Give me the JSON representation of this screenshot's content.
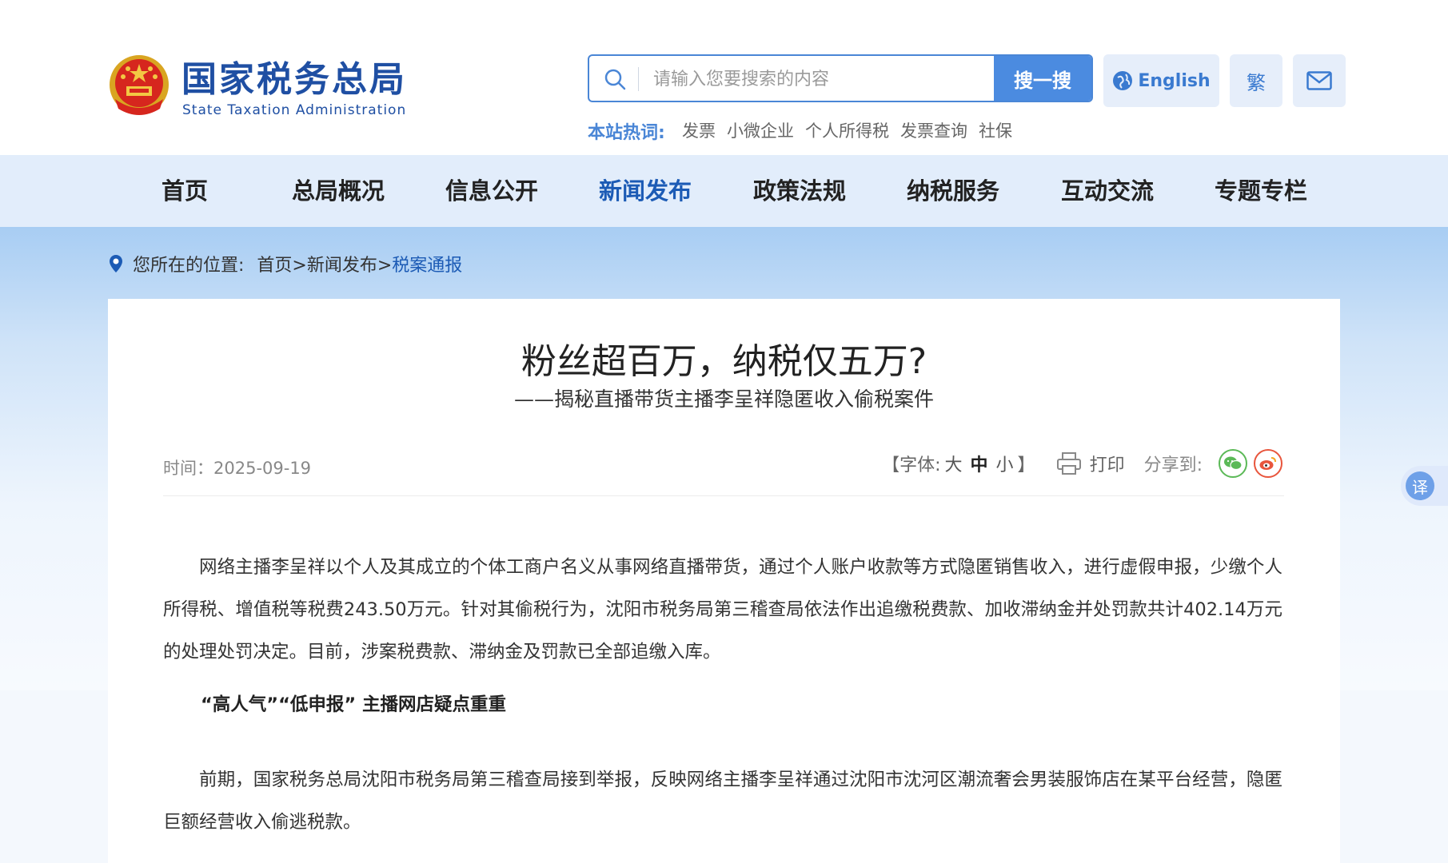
{
  "brand": {
    "title": "国家税务总局",
    "subtitle": "State Taxation Administration"
  },
  "search": {
    "placeholder": "请输入您要搜索的内容",
    "button": "搜一搜"
  },
  "utils": {
    "english": "English",
    "traditional": "繁"
  },
  "hot": {
    "label": "本站热词:",
    "items": [
      "发票",
      "小微企业",
      "个人所得税",
      "发票查询",
      "社保"
    ]
  },
  "nav": [
    "首页",
    "总局概况",
    "信息公开",
    "新闻发布",
    "政策法规",
    "纳税服务",
    "互动交流",
    "专题专栏"
  ],
  "nav_active": "新闻发布",
  "breadcrumb": {
    "label": "您所在的位置:",
    "path": "首页>新闻发布>",
    "current": "税案通报"
  },
  "article": {
    "title": "粉丝超百万，纳税仅五万?",
    "subtitle": "——揭秘直播带货主播李呈祥隐匿收入偷税案件",
    "time": "时间：2025-09-19",
    "font_open": "【字体:",
    "font_large": "大",
    "font_medium": "中",
    "font_small": "小",
    "font_close": "】",
    "print": "打印",
    "share": "分享到:",
    "p1": "网络主播李呈祥以个人及其成立的个体工商户名义从事网络直播带货，通过个人账户收款等方式隐匿销售收入，进行虚假申报，少缴个人所得税、增值税等税费243.50万元。针对其偷税行为，沈阳市税务局第三稽查局依法作出追缴税费款、加收滞纳金并处罚款共计402.14万元的处理处罚决定。目前，涉案税费款、滞纳金及罚款已全部追缴入库。",
    "heading": "“高人气”“低申报” 主播网店疑点重重",
    "p2": "前期，国家税务总局沈阳市税务局第三稽查局接到举报，反映网络主播李呈祥通过沈阳市沈河区潮流奢会男装服饰店在某平台经营，隐匿巨额经营收入偷逃税款。"
  },
  "translate": "译",
  "colors": {
    "brand": "#1f4fa3",
    "accent": "#4b8be0",
    "nav_bg": "#e2edfb"
  }
}
